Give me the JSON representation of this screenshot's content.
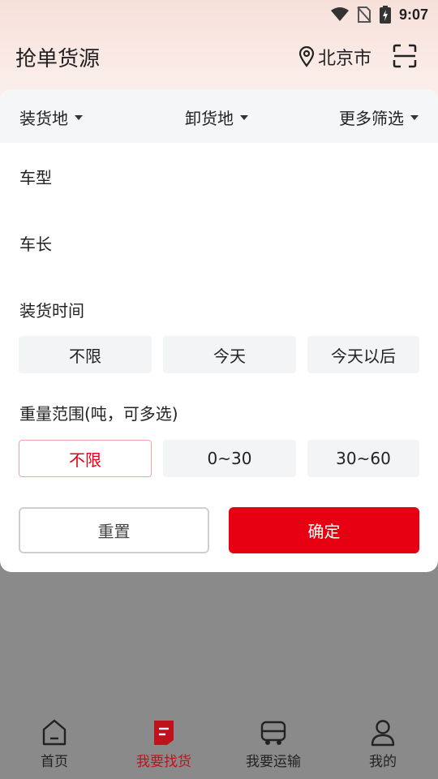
{
  "status_bar": {
    "time": "9:07"
  },
  "header": {
    "title": "抢单货源",
    "location": "北京市"
  },
  "filter_tabs": [
    {
      "label": "装货地"
    },
    {
      "label": "卸货地"
    },
    {
      "label": "更多筛选"
    }
  ],
  "filters": {
    "vehicle_type_label": "车型",
    "vehicle_length_label": "车长",
    "load_time_label": "装货时间",
    "load_time_options": [
      "不限",
      "今天",
      "今天以后"
    ],
    "weight_label": "重量范围(吨，可多选)",
    "weight_options": [
      "不限",
      "0~30",
      "30~60"
    ],
    "weight_selected": "不限"
  },
  "actions": {
    "reset": "重置",
    "confirm": "确定"
  },
  "bottom_nav": [
    {
      "label": "首页",
      "icon": "home-icon"
    },
    {
      "label": "我要找货",
      "icon": "find-goods-icon",
      "active": true
    },
    {
      "label": "我要运输",
      "icon": "truck-icon"
    },
    {
      "label": "我的",
      "icon": "profile-icon"
    }
  ],
  "colors": {
    "accent": "#e60012",
    "active_nav": "#c0121c",
    "overlay": "#8a8a8a"
  }
}
